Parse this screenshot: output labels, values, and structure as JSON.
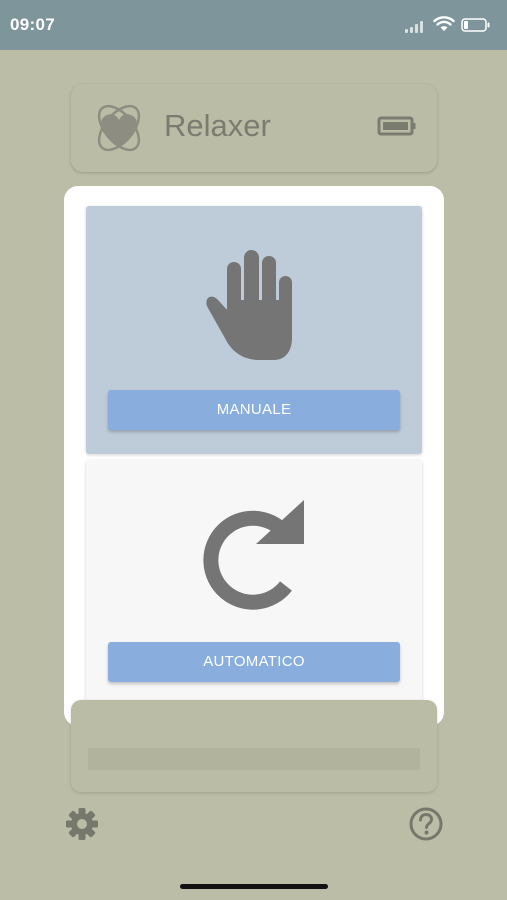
{
  "status_bar": {
    "time": "09:07",
    "icons": [
      "signal-icon",
      "wifi-icon",
      "battery-icon"
    ]
  },
  "header": {
    "logo": "heart-logo-icon",
    "title": "Relaxer",
    "device_status_icon": "battery-icon"
  },
  "modes": [
    {
      "icon": "hand-icon",
      "label": "MANUALE",
      "selected": true
    },
    {
      "icon": "refresh-icon",
      "label": "AUTOMATICO",
      "selected": false
    }
  ],
  "progress": {
    "value": 0.0
  },
  "footer": {
    "settings_icon": "gear-icon",
    "help_icon": "help-circle-icon"
  },
  "colors": {
    "background": "#bcbda7",
    "status_bar": "#7e969b",
    "selected_card": "#becbd9",
    "button": "#89aedd",
    "icon_gray": "#757575"
  }
}
